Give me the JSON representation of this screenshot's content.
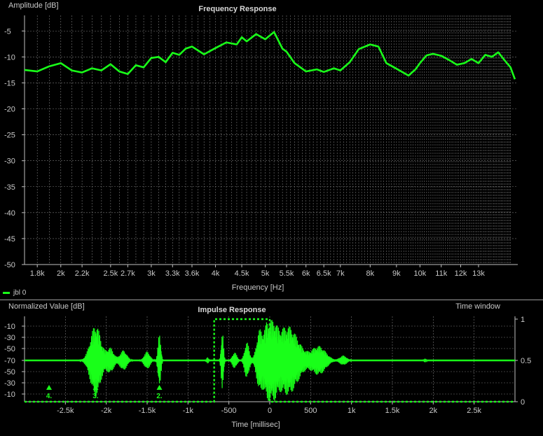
{
  "legend": {
    "label": "jbl 0",
    "color": "#19ff19"
  },
  "colors": {
    "trace": "#19ff19",
    "grid": "#7a7a7a",
    "background": "#000000",
    "axis": "#bfbfbf"
  },
  "chart_data": [
    {
      "type": "line",
      "title": "Frequency Response",
      "xlabel": "Frequency [Hz]",
      "ylabel": "Amplitude [dB]",
      "x_scale": "log",
      "xlim": [
        1700,
        15500
      ],
      "ylim": [
        -50,
        -2
      ],
      "x_ticks": [
        {
          "value": 1800,
          "label": "1.8k"
        },
        {
          "value": 2000,
          "label": "2k"
        },
        {
          "value": 2200,
          "label": "2.2k"
        },
        {
          "value": 2500,
          "label": "2.5k"
        },
        {
          "value": 2700,
          "label": "2.7k"
        },
        {
          "value": 3000,
          "label": "3k"
        },
        {
          "value": 3300,
          "label": "3.3k"
        },
        {
          "value": 3600,
          "label": "3.6k"
        },
        {
          "value": 4000,
          "label": "4k"
        },
        {
          "value": 4500,
          "label": "4.5k"
        },
        {
          "value": 5000,
          "label": "5k"
        },
        {
          "value": 5500,
          "label": "5.5k"
        },
        {
          "value": 6000,
          "label": "6k"
        },
        {
          "value": 6500,
          "label": "6.5k"
        },
        {
          "value": 7000,
          "label": "7k"
        },
        {
          "value": 8000,
          "label": "8k"
        },
        {
          "value": 9000,
          "label": "9k"
        },
        {
          "value": 10000,
          "label": "10k"
        },
        {
          "value": 11000,
          "label": "11k"
        },
        {
          "value": 12000,
          "label": "12k"
        },
        {
          "value": 13000,
          "label": "13k"
        }
      ],
      "y_ticks": [
        {
          "value": -5,
          "label": "-5"
        },
        {
          "value": -10,
          "label": "-10"
        },
        {
          "value": -15,
          "label": "-15"
        },
        {
          "value": -20,
          "label": "-20"
        },
        {
          "value": -25,
          "label": "-25"
        },
        {
          "value": -30,
          "label": "-30"
        },
        {
          "value": -35,
          "label": "-35"
        },
        {
          "value": -40,
          "label": "-40"
        },
        {
          "value": -45,
          "label": "-45"
        },
        {
          "value": -50,
          "label": "-50"
        }
      ],
      "grid": true,
      "series": [
        {
          "name": "jbl 0",
          "x": [
            1700,
            1800,
            1900,
            2000,
            2100,
            2200,
            2300,
            2400,
            2500,
            2600,
            2700,
            2800,
            2900,
            3000,
            3100,
            3200,
            3300,
            3400,
            3500,
            3600,
            3800,
            4000,
            4200,
            4400,
            4500,
            4600,
            4800,
            5000,
            5200,
            5400,
            5500,
            5700,
            6000,
            6300,
            6500,
            6800,
            7000,
            7300,
            7600,
            8000,
            8300,
            8600,
            8900,
            9200,
            9500,
            9800,
            10000,
            10300,
            10600,
            11000,
            11400,
            11800,
            12200,
            12600,
            13000,
            13400,
            13800,
            14200,
            14600,
            15000,
            15300
          ],
          "y": [
            -12.5,
            -12.8,
            -11.8,
            -11.2,
            -12.6,
            -13.0,
            -12.2,
            -12.6,
            -11.4,
            -12.8,
            -13.3,
            -11.6,
            -12.0,
            -10.2,
            -10.0,
            -11.0,
            -9.2,
            -9.6,
            -8.4,
            -8.0,
            -9.5,
            -8.3,
            -7.2,
            -7.6,
            -6.2,
            -7.0,
            -5.6,
            -6.6,
            -5.2,
            -8.4,
            -9.0,
            -11.2,
            -12.8,
            -12.4,
            -12.9,
            -12.2,
            -12.6,
            -11.0,
            -8.5,
            -7.6,
            -8.0,
            -11.2,
            -12.0,
            -12.8,
            -13.6,
            -12.4,
            -11.2,
            -9.7,
            -9.4,
            -9.8,
            -10.6,
            -11.5,
            -11.2,
            -10.4,
            -11.2,
            -9.6,
            -10.0,
            -9.1,
            -10.6,
            -12.0,
            -14.3
          ]
        }
      ]
    },
    {
      "type": "line",
      "title": "Impulse Response",
      "xlabel": "Time [millisec]",
      "ylabel": "Normalized Value [dB]",
      "y2label": "Time window",
      "xlim": [
        -3000,
        3000
      ],
      "ylim": [
        -10,
        -10
      ],
      "x_ticks": [
        {
          "value": -2500,
          "label": "-2.5k"
        },
        {
          "value": -2000,
          "label": "-2k"
        },
        {
          "value": -1500,
          "label": "-1.5k"
        },
        {
          "value": -1000,
          "label": "-1k"
        },
        {
          "value": -500,
          "label": "-500"
        },
        {
          "value": 0,
          "label": "0"
        },
        {
          "value": 500,
          "label": "500"
        },
        {
          "value": 1000,
          "label": "1k"
        },
        {
          "value": 1500,
          "label": "1.5k"
        },
        {
          "value": 2000,
          "label": "2k"
        },
        {
          "value": 2500,
          "label": "2.5k"
        }
      ],
      "y_tick_labels": [
        "-10",
        "-30",
        "-50",
        "-70",
        "-50",
        "-30",
        "-10"
      ],
      "y2_ticks": [
        {
          "value": 1,
          "label": "1"
        },
        {
          "value": 0.5,
          "label": "0.5"
        },
        {
          "value": 0,
          "label": "0"
        }
      ],
      "grid": true,
      "markers": [
        {
          "time": -2700,
          "label": "4."
        },
        {
          "time": -2130,
          "label": "3."
        },
        {
          "time": -1350,
          "label": "2."
        }
      ],
      "time_window": {
        "start": -680,
        "end": 0,
        "level_high": 1,
        "level_low": 0
      },
      "bursts": [
        {
          "time": -2130,
          "amplitude": 0.88,
          "width": 90
        },
        {
          "time": -1950,
          "amplitude": 0.3,
          "width": 60
        },
        {
          "time": -1790,
          "amplitude": 0.25,
          "width": 60
        },
        {
          "time": -1500,
          "amplitude": 0.22,
          "width": 50
        },
        {
          "time": -1350,
          "amplitude": 0.65,
          "width": 25
        },
        {
          "time": -760,
          "amplitude": 0.08,
          "width": 20
        },
        {
          "time": -580,
          "amplitude": 0.72,
          "width": 20
        },
        {
          "time": -430,
          "amplitude": 0.2,
          "width": 40
        },
        {
          "time": -280,
          "amplitude": 0.45,
          "width": 40
        },
        {
          "time": -130,
          "amplitude": 0.6,
          "width": 50
        },
        {
          "time": 0,
          "amplitude": 1.0,
          "width": 90
        },
        {
          "time": 220,
          "amplitude": 0.85,
          "width": 180
        },
        {
          "time": 600,
          "amplitude": 0.35,
          "width": 120
        },
        {
          "time": 900,
          "amplitude": 0.12,
          "width": 60
        },
        {
          "time": 1900,
          "amplitude": 0.05,
          "width": 20
        }
      ]
    }
  ]
}
